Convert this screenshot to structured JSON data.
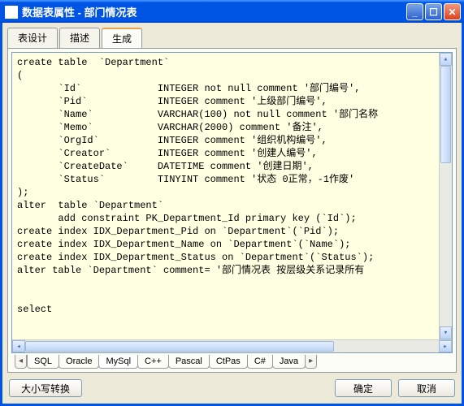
{
  "window": {
    "title": "数据表属性 - 部门情况表"
  },
  "topTabs": {
    "t0": "表设计",
    "t1": "描述",
    "t2": "生成"
  },
  "sql": "create table  `Department`\n(\n       `Id`             INTEGER not null comment '部门编号',\n       `Pid`            INTEGER comment '上级部门编号',\n       `Name`           VARCHAR(100) not null comment '部门名称\n       `Memo`           VARCHAR(2000) comment '备注',\n       `OrgId`          INTEGER comment '组织机构编号',\n       `Creator`        INTEGER comment '创建人编号',\n       `CreateDate`     DATETIME comment '创建日期',\n       `Status`         TINYINT comment '状态 0正常，-1作废'\n);\nalter  table `Department`\n       add constraint PK_Department_Id primary key (`Id`);\ncreate index IDX_Department_Pid on `Department`(`Pid`);\ncreate index IDX_Department_Name on `Department`(`Name`);\ncreate index IDX_Department_Status on `Department`(`Status`);\nalter table `Department` comment= '部门情况表 按层级关系记录所有\n\n\nselect",
  "langTabs": {
    "l0": "SQL",
    "l1": "Oracle",
    "l2": "MySql",
    "l3": "C++",
    "l4": "Pascal",
    "l5": "CtPas",
    "l6": "C#",
    "l7": "Java"
  },
  "buttons": {
    "caseToggle": "大小写转换",
    "ok": "确定",
    "cancel": "取消"
  }
}
